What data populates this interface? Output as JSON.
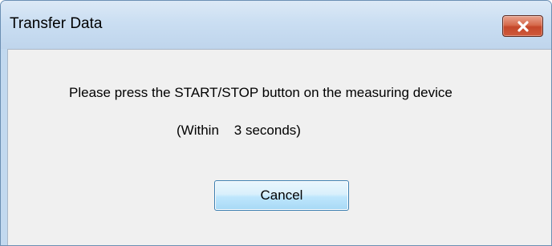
{
  "window": {
    "title": "Transfer Data"
  },
  "title_bar": {
    "close_icon": "close-icon"
  },
  "dialog": {
    "message": "Please press the START/STOP button on the measuring device",
    "timeout_text": "(Within    3 seconds)",
    "cancel_label": "Cancel"
  },
  "colors": {
    "title_bar": "#c9ddf1",
    "client_background": "#f0f0f0",
    "close_button": "#c94a2c",
    "button_border": "#3c7fb1"
  }
}
